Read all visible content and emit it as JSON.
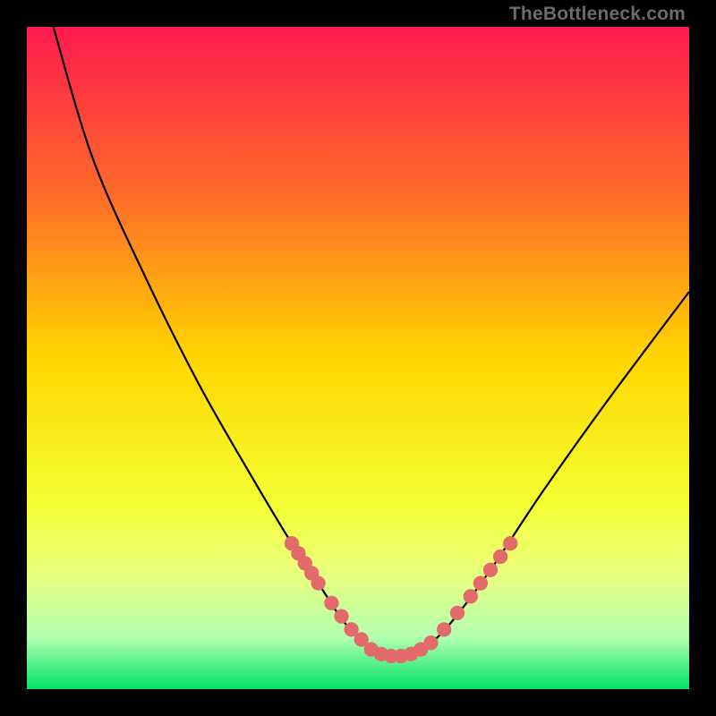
{
  "watermark": "TheBottleneck.com",
  "chart_data": {
    "type": "line",
    "title": "",
    "xlabel": "",
    "ylabel": "",
    "xlim": [
      0,
      100
    ],
    "ylim": [
      0,
      100
    ],
    "grid": false,
    "gradient_stops": [
      {
        "offset": 0,
        "color": "#ff1a4f"
      },
      {
        "offset": 25,
        "color": "#ff6a2a"
      },
      {
        "offset": 50,
        "color": "#ffd600"
      },
      {
        "offset": 72,
        "color": "#f4ff33"
      },
      {
        "offset": 82,
        "color": "#eaff7a"
      },
      {
        "offset": 92,
        "color": "#b5ffb0"
      },
      {
        "offset": 100,
        "color": "#00e36a"
      }
    ],
    "series": [
      {
        "name": "bottleneck-curve",
        "color": "#000000",
        "x": [
          4,
          10,
          18,
          26,
          34,
          40,
          44,
          48,
          52,
          54,
          56,
          58,
          60,
          64,
          70,
          78,
          88,
          100
        ],
        "y": [
          100,
          80,
          62,
          46,
          32,
          22,
          16,
          10,
          6,
          5,
          5,
          5,
          6,
          10,
          18,
          30,
          44,
          60
        ]
      }
    ],
    "bead_cluster": {
      "name": "highlight-beads",
      "color": "#e36a6a",
      "radius": 1.1,
      "points": [
        {
          "x": 40.0,
          "y": 22.0
        },
        {
          "x": 41.0,
          "y": 20.5
        },
        {
          "x": 42.0,
          "y": 19.0
        },
        {
          "x": 43.0,
          "y": 17.5
        },
        {
          "x": 44.0,
          "y": 16.0
        },
        {
          "x": 46.0,
          "y": 13.0
        },
        {
          "x": 47.5,
          "y": 11.0
        },
        {
          "x": 49.0,
          "y": 9.0
        },
        {
          "x": 50.5,
          "y": 7.5
        },
        {
          "x": 52.0,
          "y": 6.0
        },
        {
          "x": 53.5,
          "y": 5.3
        },
        {
          "x": 55.0,
          "y": 5.0
        },
        {
          "x": 56.5,
          "y": 5.0
        },
        {
          "x": 58.0,
          "y": 5.3
        },
        {
          "x": 59.5,
          "y": 6.0
        },
        {
          "x": 61.0,
          "y": 7.0
        },
        {
          "x": 63.0,
          "y": 9.0
        },
        {
          "x": 65.0,
          "y": 11.5
        },
        {
          "x": 67.0,
          "y": 14.0
        },
        {
          "x": 68.5,
          "y": 16.0
        },
        {
          "x": 70.0,
          "y": 18.0
        },
        {
          "x": 71.5,
          "y": 20.0
        },
        {
          "x": 73.0,
          "y": 22.0
        }
      ]
    }
  }
}
